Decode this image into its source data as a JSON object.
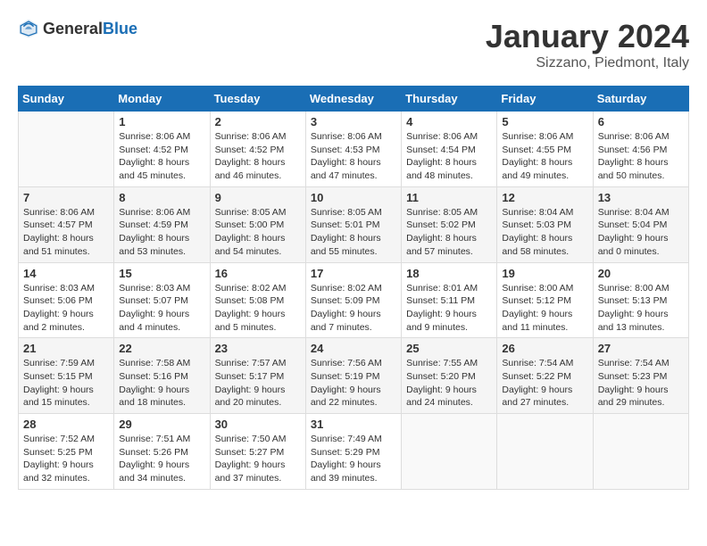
{
  "header": {
    "logo_general": "General",
    "logo_blue": "Blue",
    "title": "January 2024",
    "subtitle": "Sizzano, Piedmont, Italy"
  },
  "columns": [
    "Sunday",
    "Monday",
    "Tuesday",
    "Wednesday",
    "Thursday",
    "Friday",
    "Saturday"
  ],
  "weeks": [
    [
      {
        "day": "",
        "info": ""
      },
      {
        "day": "1",
        "info": "Sunrise: 8:06 AM\nSunset: 4:52 PM\nDaylight: 8 hours\nand 45 minutes."
      },
      {
        "day": "2",
        "info": "Sunrise: 8:06 AM\nSunset: 4:52 PM\nDaylight: 8 hours\nand 46 minutes."
      },
      {
        "day": "3",
        "info": "Sunrise: 8:06 AM\nSunset: 4:53 PM\nDaylight: 8 hours\nand 47 minutes."
      },
      {
        "day": "4",
        "info": "Sunrise: 8:06 AM\nSunset: 4:54 PM\nDaylight: 8 hours\nand 48 minutes."
      },
      {
        "day": "5",
        "info": "Sunrise: 8:06 AM\nSunset: 4:55 PM\nDaylight: 8 hours\nand 49 minutes."
      },
      {
        "day": "6",
        "info": "Sunrise: 8:06 AM\nSunset: 4:56 PM\nDaylight: 8 hours\nand 50 minutes."
      }
    ],
    [
      {
        "day": "7",
        "info": "Sunrise: 8:06 AM\nSunset: 4:57 PM\nDaylight: 8 hours\nand 51 minutes."
      },
      {
        "day": "8",
        "info": "Sunrise: 8:06 AM\nSunset: 4:59 PM\nDaylight: 8 hours\nand 53 minutes."
      },
      {
        "day": "9",
        "info": "Sunrise: 8:05 AM\nSunset: 5:00 PM\nDaylight: 8 hours\nand 54 minutes."
      },
      {
        "day": "10",
        "info": "Sunrise: 8:05 AM\nSunset: 5:01 PM\nDaylight: 8 hours\nand 55 minutes."
      },
      {
        "day": "11",
        "info": "Sunrise: 8:05 AM\nSunset: 5:02 PM\nDaylight: 8 hours\nand 57 minutes."
      },
      {
        "day": "12",
        "info": "Sunrise: 8:04 AM\nSunset: 5:03 PM\nDaylight: 8 hours\nand 58 minutes."
      },
      {
        "day": "13",
        "info": "Sunrise: 8:04 AM\nSunset: 5:04 PM\nDaylight: 9 hours\nand 0 minutes."
      }
    ],
    [
      {
        "day": "14",
        "info": "Sunrise: 8:03 AM\nSunset: 5:06 PM\nDaylight: 9 hours\nand 2 minutes."
      },
      {
        "day": "15",
        "info": "Sunrise: 8:03 AM\nSunset: 5:07 PM\nDaylight: 9 hours\nand 4 minutes."
      },
      {
        "day": "16",
        "info": "Sunrise: 8:02 AM\nSunset: 5:08 PM\nDaylight: 9 hours\nand 5 minutes."
      },
      {
        "day": "17",
        "info": "Sunrise: 8:02 AM\nSunset: 5:09 PM\nDaylight: 9 hours\nand 7 minutes."
      },
      {
        "day": "18",
        "info": "Sunrise: 8:01 AM\nSunset: 5:11 PM\nDaylight: 9 hours\nand 9 minutes."
      },
      {
        "day": "19",
        "info": "Sunrise: 8:00 AM\nSunset: 5:12 PM\nDaylight: 9 hours\nand 11 minutes."
      },
      {
        "day": "20",
        "info": "Sunrise: 8:00 AM\nSunset: 5:13 PM\nDaylight: 9 hours\nand 13 minutes."
      }
    ],
    [
      {
        "day": "21",
        "info": "Sunrise: 7:59 AM\nSunset: 5:15 PM\nDaylight: 9 hours\nand 15 minutes."
      },
      {
        "day": "22",
        "info": "Sunrise: 7:58 AM\nSunset: 5:16 PM\nDaylight: 9 hours\nand 18 minutes."
      },
      {
        "day": "23",
        "info": "Sunrise: 7:57 AM\nSunset: 5:17 PM\nDaylight: 9 hours\nand 20 minutes."
      },
      {
        "day": "24",
        "info": "Sunrise: 7:56 AM\nSunset: 5:19 PM\nDaylight: 9 hours\nand 22 minutes."
      },
      {
        "day": "25",
        "info": "Sunrise: 7:55 AM\nSunset: 5:20 PM\nDaylight: 9 hours\nand 24 minutes."
      },
      {
        "day": "26",
        "info": "Sunrise: 7:54 AM\nSunset: 5:22 PM\nDaylight: 9 hours\nand 27 minutes."
      },
      {
        "day": "27",
        "info": "Sunrise: 7:54 AM\nSunset: 5:23 PM\nDaylight: 9 hours\nand 29 minutes."
      }
    ],
    [
      {
        "day": "28",
        "info": "Sunrise: 7:52 AM\nSunset: 5:25 PM\nDaylight: 9 hours\nand 32 minutes."
      },
      {
        "day": "29",
        "info": "Sunrise: 7:51 AM\nSunset: 5:26 PM\nDaylight: 9 hours\nand 34 minutes."
      },
      {
        "day": "30",
        "info": "Sunrise: 7:50 AM\nSunset: 5:27 PM\nDaylight: 9 hours\nand 37 minutes."
      },
      {
        "day": "31",
        "info": "Sunrise: 7:49 AM\nSunset: 5:29 PM\nDaylight: 9 hours\nand 39 minutes."
      },
      {
        "day": "",
        "info": ""
      },
      {
        "day": "",
        "info": ""
      },
      {
        "day": "",
        "info": ""
      }
    ]
  ]
}
